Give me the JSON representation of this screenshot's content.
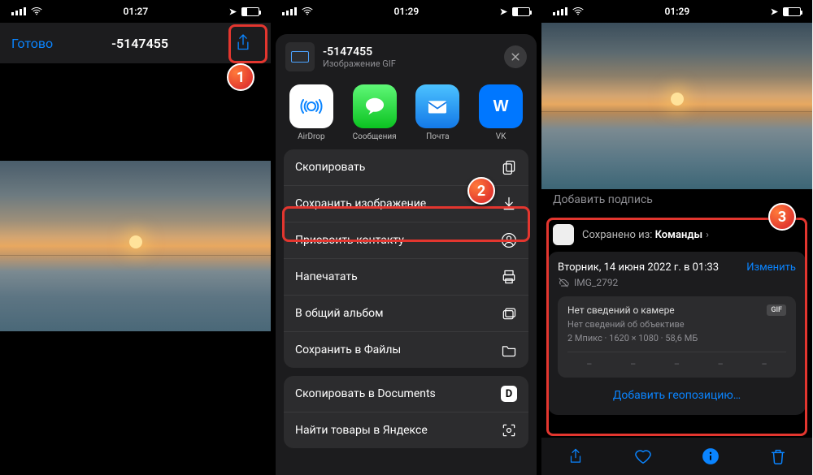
{
  "status": {
    "time1": "01:27",
    "time2": "01:29",
    "time3": "01:29"
  },
  "p1": {
    "done": "Готово",
    "title": "-5147455"
  },
  "p2": {
    "title": "-5147455",
    "subtitle": "Изображение GIF",
    "apps": {
      "airdrop": "AirDrop",
      "messages": "Сообщения",
      "mail": "Почта",
      "vk": "VK"
    },
    "actions": {
      "copy": "Скопировать",
      "save_image": "Сохранить изображение",
      "assign_contact": "Присвоить контакту",
      "print": "Напечатать",
      "shared_album": "В общий альбом",
      "save_files": "Сохранить в Файлы",
      "copy_documents": "Скопировать в Documents",
      "yandex": "Найти товары в Яндексе"
    }
  },
  "p3": {
    "caption_placeholder": "Добавить подпись",
    "saved_prefix": "Сохранено из:",
    "saved_app": "Команды",
    "date": "Вторник, 14 июня 2022 г. в 01:33",
    "edit": "Изменить",
    "filename": "IMG_2792",
    "no_camera": "Нет сведений о камере",
    "gif": "GIF",
    "no_lens": "Нет сведений об объективе",
    "specs": "2 Мпикс  ·  1620 × 1080  ·  58,6 МБ",
    "add_geo": "Добавить геопозицию…"
  },
  "badges": {
    "one": "1",
    "two": "2",
    "three": "3"
  }
}
